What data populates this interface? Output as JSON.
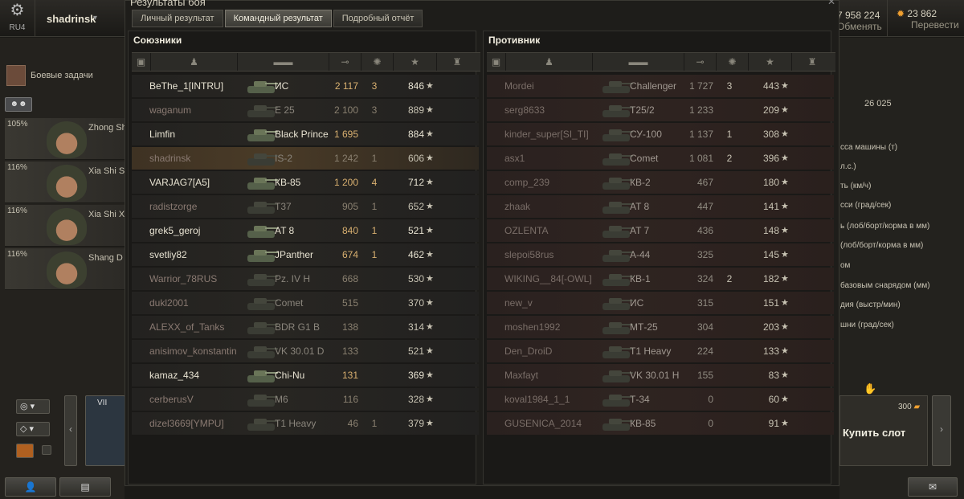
{
  "topbar": {
    "server": "RU4",
    "player": "shadrinsk",
    "credits": "7 958 224",
    "exchange_label": "Обменять",
    "gold": "23 862",
    "transfer_label": "Перевести"
  },
  "left": {
    "tasks_label": "Боевые задачи",
    "crew": [
      {
        "pct": "105%",
        "name": "Zhong Sh"
      },
      {
        "pct": "116%",
        "name": "Xia Shi S"
      },
      {
        "pct": "116%",
        "name": "Xia Shi X"
      },
      {
        "pct": "116%",
        "name": "Shang D"
      }
    ],
    "tank_tier": "VII"
  },
  "right": {
    "value": "26 025",
    "params": [
      "сса машины (т)",
      "л.с.)",
      "ть (км/ч)",
      "сси (град/сек)",
      "ь (лоб/борт/корма в мм)",
      "(лоб/борт/корма в мм)",
      "ом",
      "базовым снарядом (мм)",
      "дия (выстр/мин)",
      "шни (град/сек)"
    ],
    "buy_slot_label": "Купить слот",
    "buy_slot_cost": "300"
  },
  "window": {
    "title": "Результаты боя",
    "tabs": [
      {
        "label": "Личный результат",
        "active": false
      },
      {
        "label": "Командный результат",
        "active": true
      },
      {
        "label": "Подробный отчёт",
        "active": false
      }
    ]
  },
  "allies": {
    "title": "Союзники",
    "rows": [
      {
        "player": "BeThe_1[INTRU]",
        "tank": "ИС",
        "damage": "2 117",
        "kills": "3",
        "xp": "846",
        "dead": false,
        "me": false
      },
      {
        "player": "waganum",
        "tank": "Е 25",
        "damage": "2 100",
        "kills": "3",
        "xp": "889",
        "dead": true,
        "me": false
      },
      {
        "player": "Limfin",
        "tank": "Black Prince",
        "damage": "1 695",
        "kills": "",
        "xp": "884",
        "dead": false,
        "me": false
      },
      {
        "player": "shadrinsk",
        "tank": "IS-2",
        "damage": "1 242",
        "kills": "1",
        "xp": "606",
        "dead": true,
        "me": true
      },
      {
        "player": "VARJAG7[A5]",
        "tank": "КВ-85",
        "damage": "1 200",
        "kills": "4",
        "xp": "712",
        "dead": false,
        "me": false
      },
      {
        "player": "radistzorge",
        "tank": "T37",
        "damage": "905",
        "kills": "1",
        "xp": "652",
        "dead": true,
        "me": false
      },
      {
        "player": "grek5_geroj",
        "tank": "AT 8",
        "damage": "840",
        "kills": "1",
        "xp": "521",
        "dead": false,
        "me": false
      },
      {
        "player": "svetliy82",
        "tank": "JPanther",
        "damage": "674",
        "kills": "1",
        "xp": "462",
        "dead": false,
        "me": false
      },
      {
        "player": "Warrior_78RUS",
        "tank": "Pz. IV H",
        "damage": "668",
        "kills": "",
        "xp": "530",
        "dead": true,
        "me": false
      },
      {
        "player": "dukl2001",
        "tank": "Comet",
        "damage": "515",
        "kills": "",
        "xp": "370",
        "dead": true,
        "me": false
      },
      {
        "player": "ALEXX_of_Tanks",
        "tank": "BDR G1 B",
        "damage": "138",
        "kills": "",
        "xp": "314",
        "dead": true,
        "me": false
      },
      {
        "player": "anisimov_konstantin..",
        "tank": "VK 30.01 D",
        "damage": "133",
        "kills": "",
        "xp": "521",
        "dead": true,
        "me": false
      },
      {
        "player": "kamaz_434",
        "tank": "Chi-Nu",
        "damage": "131",
        "kills": "",
        "xp": "369",
        "dead": false,
        "me": false
      },
      {
        "player": "cerberusV",
        "tank": "M6",
        "damage": "116",
        "kills": "",
        "xp": "328",
        "dead": true,
        "me": false
      },
      {
        "player": "dizel3669[YMPU]",
        "tank": "T1 Heavy",
        "damage": "46",
        "kills": "1",
        "xp": "379",
        "dead": true,
        "me": false
      }
    ]
  },
  "enemies": {
    "title": "Противник",
    "rows": [
      {
        "player": "Mordei",
        "tank": "Challenger",
        "damage": "1 727",
        "kills": "3",
        "xp": "443",
        "dead": true
      },
      {
        "player": "serg8633",
        "tank": "T25/2",
        "damage": "1 233",
        "kills": "",
        "xp": "209",
        "dead": true
      },
      {
        "player": "kinder_super[SI_TI]",
        "tank": "СУ-100",
        "damage": "1 137",
        "kills": "1",
        "xp": "308",
        "dead": true
      },
      {
        "player": "asx1",
        "tank": "Comet",
        "damage": "1 081",
        "kills": "2",
        "xp": "396",
        "dead": true
      },
      {
        "player": "comp_239",
        "tank": "КВ-2",
        "damage": "467",
        "kills": "",
        "xp": "180",
        "dead": true
      },
      {
        "player": "zhaak",
        "tank": "AT 8",
        "damage": "447",
        "kills": "",
        "xp": "141",
        "dead": true
      },
      {
        "player": "OZLENTA",
        "tank": "AT 7",
        "damage": "436",
        "kills": "",
        "xp": "148",
        "dead": true
      },
      {
        "player": "slepoi58rus",
        "tank": "А-44",
        "damage": "325",
        "kills": "",
        "xp": "145",
        "dead": true
      },
      {
        "player": "WIKING__84[-OWL]",
        "tank": "КВ-1",
        "damage": "324",
        "kills": "2",
        "xp": "182",
        "dead": true
      },
      {
        "player": "new_v",
        "tank": "ИС",
        "damage": "315",
        "kills": "",
        "xp": "151",
        "dead": true
      },
      {
        "player": "moshen1992",
        "tank": "МТ-25",
        "damage": "304",
        "kills": "",
        "xp": "203",
        "dead": true
      },
      {
        "player": "Den_DroiD",
        "tank": "T1 Heavy",
        "damage": "224",
        "kills": "",
        "xp": "133",
        "dead": true
      },
      {
        "player": "Maxfayt",
        "tank": "VK 30.01 H",
        "damage": "155",
        "kills": "",
        "xp": "83",
        "dead": true
      },
      {
        "player": "koval1984_1_1",
        "tank": "Т-34",
        "damage": "0",
        "kills": "",
        "xp": "60",
        "dead": true
      },
      {
        "player": "GUSENICA_2014",
        "tank": "КВ-85",
        "damage": "0",
        "kills": "",
        "xp": "91",
        "dead": true
      }
    ]
  },
  "column_icons": [
    "platoon-icon",
    "player-icon",
    "tank-icon",
    "damage-icon",
    "kills-icon",
    "xp-icon",
    "medal-icon"
  ],
  "colors": {
    "damage": "#d9b070",
    "me_row": "#4a3b27",
    "ally_row": "#282622",
    "enemy_row": "#2f2421"
  }
}
